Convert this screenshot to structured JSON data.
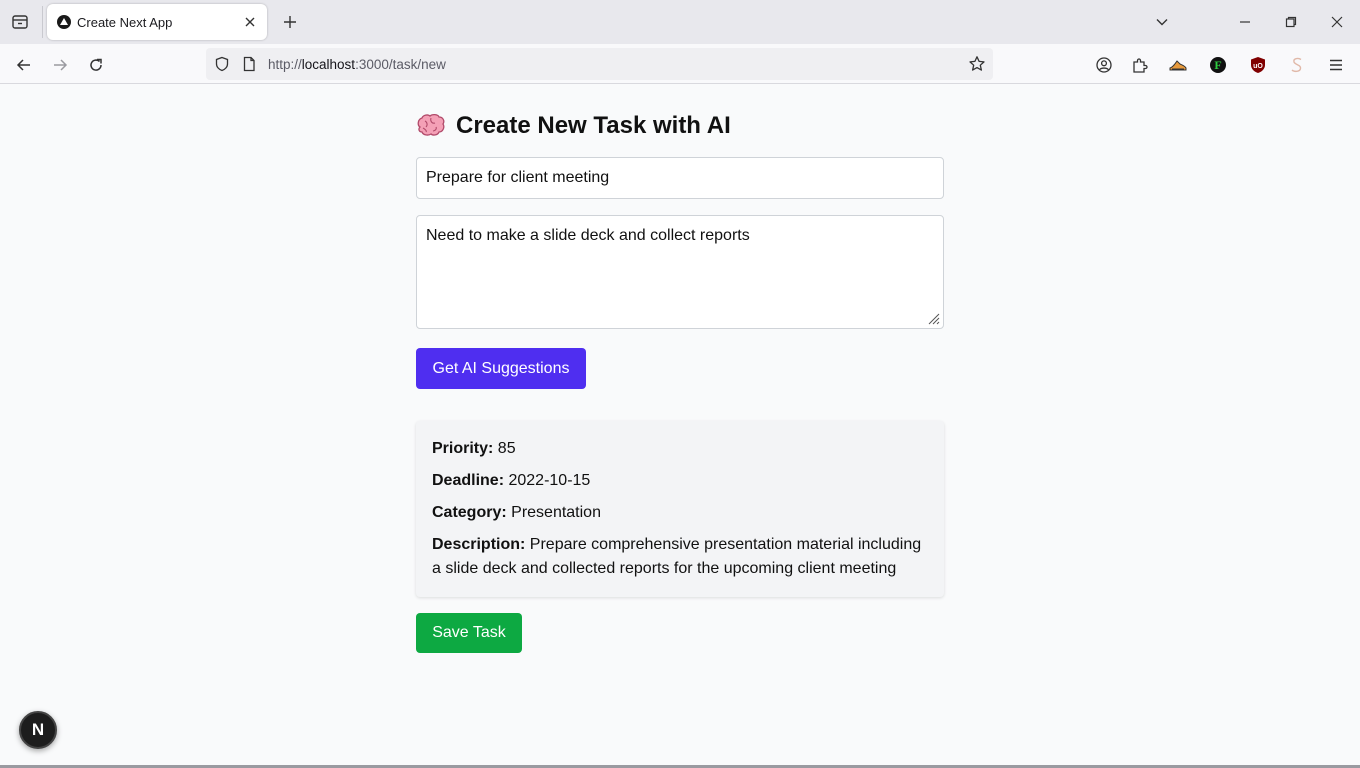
{
  "browser": {
    "tab_title": "Create Next App",
    "url_prefix": "http://",
    "url_host": "localhost",
    "url_path": ":3000/task/new"
  },
  "page": {
    "emoji": "brain",
    "title": "Create New Task with AI",
    "task_title_value": "Prepare for client meeting",
    "task_description_value": "Need to make a slide deck and collect reports",
    "ai_button_label": "Get AI Suggestions",
    "suggestions": {
      "priority_label": "Priority:",
      "priority_value": "85",
      "deadline_label": "Deadline:",
      "deadline_value": "2022-10-15",
      "category_label": "Category:",
      "category_value": "Presentation",
      "description_label": "Description:",
      "description_value": "Prepare comprehensive presentation material including a slide deck and collected reports for the upcoming client meeting"
    },
    "save_button_label": "Save Task",
    "next_badge_letter": "N"
  },
  "colors": {
    "ai_button": "#4f2ef0",
    "save_button": "#0da942",
    "page_background": "#f9fafb"
  }
}
